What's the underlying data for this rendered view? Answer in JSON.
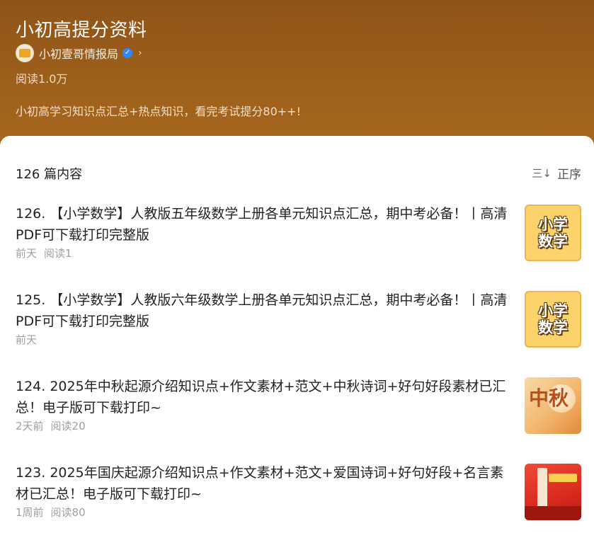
{
  "header": {
    "title": "小初高提分资料",
    "author": "小初壹哥情报局",
    "chevron": "›",
    "verified_mark": "✓",
    "read_count": "阅读1.0万",
    "description": "小初高学习知识点汇总+热点知识，看完考试提分80++!"
  },
  "list": {
    "count_label": "126 篇内容",
    "sort_label": "正序",
    "sort_icon": "三↓",
    "items": [
      {
        "title": "126. 【小学数学】人教版五年级数学上册各单元知识点汇总，期中考必备！丨高清PDF可下载打印完整版",
        "date": "前天",
        "reads": "阅读1",
        "thumb_text": [
          "小学",
          "数学"
        ]
      },
      {
        "title": "125. 【小学数学】人教版六年级数学上册各单元知识点汇总，期中考必备！丨高清PDF可下载打印完整版",
        "date": "前天",
        "reads": "",
        "thumb_text": [
          "小学",
          "数学"
        ]
      },
      {
        "title": "124. 2025年中秋起源介绍知识点+作文素材+范文+中秋诗词+好句好段素材已汇总！电子版可下载打印~",
        "date": "2天前",
        "reads": "阅读20",
        "thumb_text": [
          "中秋"
        ]
      },
      {
        "title": "123. 2025年国庆起源介绍知识点+作文素材+范文+爱国诗词+好句好段+名言素材已汇总！电子版可下载打印~",
        "date": "1周前",
        "reads": "阅读80",
        "thumb_text": []
      }
    ]
  },
  "colors": {
    "header_top": "#8e5418",
    "header_bottom": "#a8691f",
    "verify_blue": "#2f86f6"
  },
  "icons": {
    "avatar": "avatar-icon",
    "verified": "verified-icon",
    "chevron": "chevron-right-icon",
    "sort": "sort-icon"
  }
}
